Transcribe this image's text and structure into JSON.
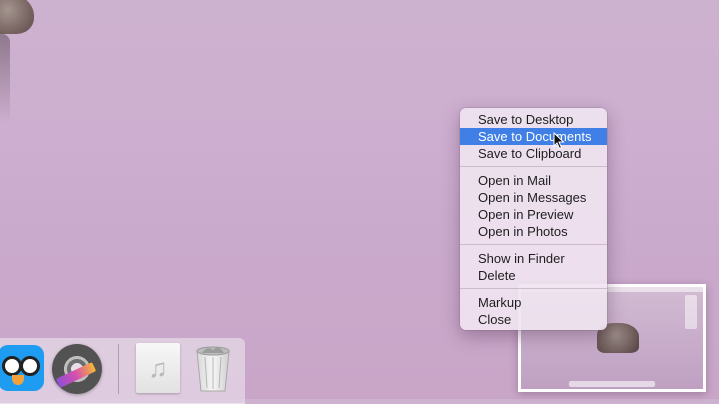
{
  "context_menu": {
    "groups": [
      [
        {
          "label": "Save to Desktop",
          "selected": false
        },
        {
          "label": "Save to Documents",
          "selected": true
        },
        {
          "label": "Save to Clipboard",
          "selected": false
        }
      ],
      [
        {
          "label": "Open in Mail",
          "selected": false
        },
        {
          "label": "Open in Messages",
          "selected": false
        },
        {
          "label": "Open in Preview",
          "selected": false
        },
        {
          "label": "Open in Photos",
          "selected": false
        }
      ],
      [
        {
          "label": "Show in Finder",
          "selected": false
        },
        {
          "label": "Delete",
          "selected": false
        }
      ],
      [
        {
          "label": "Markup",
          "selected": false
        },
        {
          "label": "Close",
          "selected": false
        }
      ]
    ]
  },
  "dock": {
    "icons": [
      {
        "name": "tweetbot-icon"
      },
      {
        "name": "final-cut-icon"
      },
      {
        "name": "music-file-icon",
        "glyph": "♫"
      },
      {
        "name": "trash-icon"
      }
    ]
  },
  "colors": {
    "selection": "#3f7fe6",
    "desktop": "#cdb2cf"
  }
}
